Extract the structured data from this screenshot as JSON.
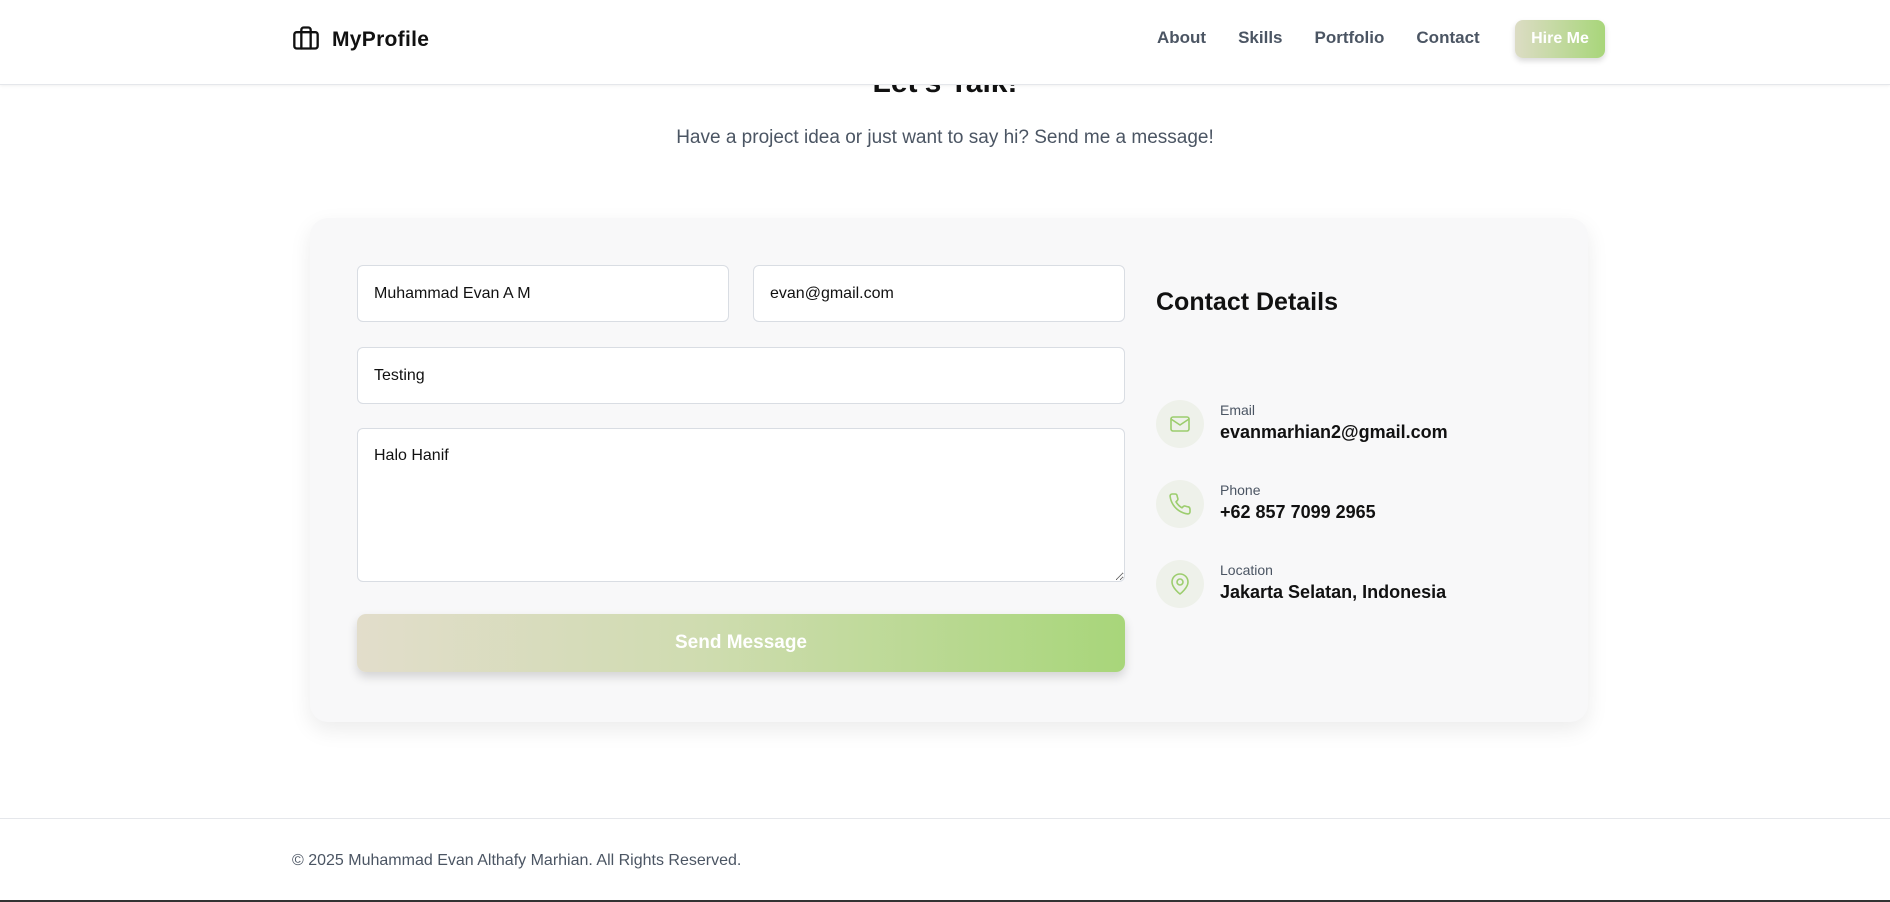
{
  "nav": {
    "brand": "MyProfile",
    "links": [
      "About",
      "Skills",
      "Portfolio",
      "Contact"
    ],
    "hire_label": "Hire Me"
  },
  "section": {
    "title": "Let's Talk!",
    "subtitle": "Have a project idea or just want to say hi? Send me a message!"
  },
  "form": {
    "name_value": "Muhammad Evan A M",
    "email_value": "evan@gmail.com",
    "subject_value": "Testing",
    "message_value": "Halo Hanif",
    "send_label": "Send Message"
  },
  "contact_details": {
    "title": "Contact Details",
    "items": [
      {
        "label": "Email",
        "value": "evanmarhian2@gmail.com",
        "icon": "mail-icon"
      },
      {
        "label": "Phone",
        "value": "+62 857 7099 2965",
        "icon": "phone-icon"
      },
      {
        "label": "Location",
        "value": "Jakarta Selatan, Indonesia",
        "icon": "map-pin-icon"
      }
    ]
  },
  "footer": {
    "copyright": "© 2025 Muhammad Evan Althafy Marhian. All Rights Reserved."
  },
  "colors": {
    "accent": "#a8d67a",
    "accent_start": "#dcdcc4",
    "text_muted": "#4b5563",
    "card_bg": "#f8f8f9"
  }
}
